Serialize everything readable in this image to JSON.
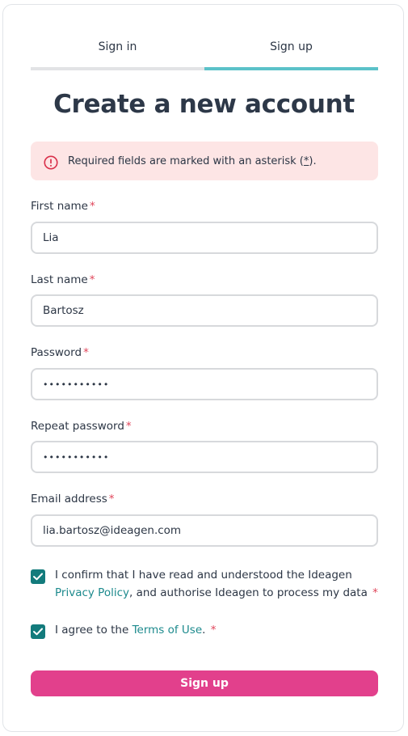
{
  "tabs": {
    "signin_label": "Sign in",
    "signup_label": "Sign up"
  },
  "title": "Create a new account",
  "alert": {
    "icon": "alert-circle-icon",
    "text_before": "Required fields are marked with an asterisk (",
    "asterisk": "*",
    "text_after": ")."
  },
  "fields": {
    "first_name": {
      "label": "First name",
      "required": "*",
      "value": "Lia"
    },
    "last_name": {
      "label": "Last name",
      "required": "*",
      "value": "Bartosz"
    },
    "password": {
      "label": "Password",
      "required": "*",
      "value": "•••••••••••"
    },
    "repeat_password": {
      "label": "Repeat password",
      "required": "*",
      "value": "•••••••••••"
    },
    "email": {
      "label": "Email address",
      "required": "*",
      "value": "lia.bartosz@ideagen.com"
    }
  },
  "consent": {
    "privacy": {
      "checked": true,
      "text_before": "I confirm that I have read and understood the Ideagen ",
      "link": "Privacy Policy",
      "text_after": ", and authorise Ideagen to process my data",
      "required": "*"
    },
    "terms": {
      "checked": true,
      "text_before": "I agree to the ",
      "link": "Terms of Use",
      "text_after": ".",
      "required": "*"
    }
  },
  "submit_label": "Sign up",
  "colors": {
    "accent_teal": "#5bc2c9",
    "checkbox": "#137b7c",
    "link": "#1d8a8d",
    "button": "#e2408c",
    "alert_bg": "#fde5e5",
    "required": "#e0455a"
  }
}
